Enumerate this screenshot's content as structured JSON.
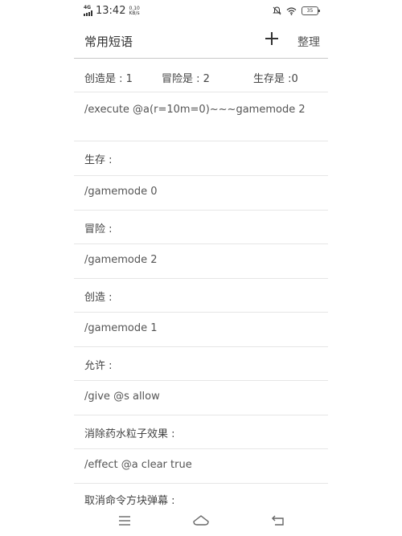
{
  "status_bar": {
    "network_type": "4G",
    "time": "13:42",
    "speed_value": "0.10",
    "speed_unit": "KB/s",
    "battery": "35"
  },
  "app_bar": {
    "title": "常用短语",
    "organize_label": "整理",
    "add_icon": "plus-icon"
  },
  "stats": [
    "创造是 : 1",
    "冒险是 : 2",
    "生存是 :0"
  ],
  "phrases": [
    "/execute @a(r=10m=0)~~~gamemode 2",
    "生存 :",
    "/gamemode 0",
    "冒险 :",
    "/gamemode 2",
    "创造 :",
    "/gamemode 1",
    "允许 :",
    "/give @s allow",
    "消除药水粒子效果 :",
    "/effect @a clear true",
    "取消命令方块弹幕 :"
  ],
  "nav_icons": [
    "menu-icon",
    "home-icon",
    "back-icon"
  ]
}
